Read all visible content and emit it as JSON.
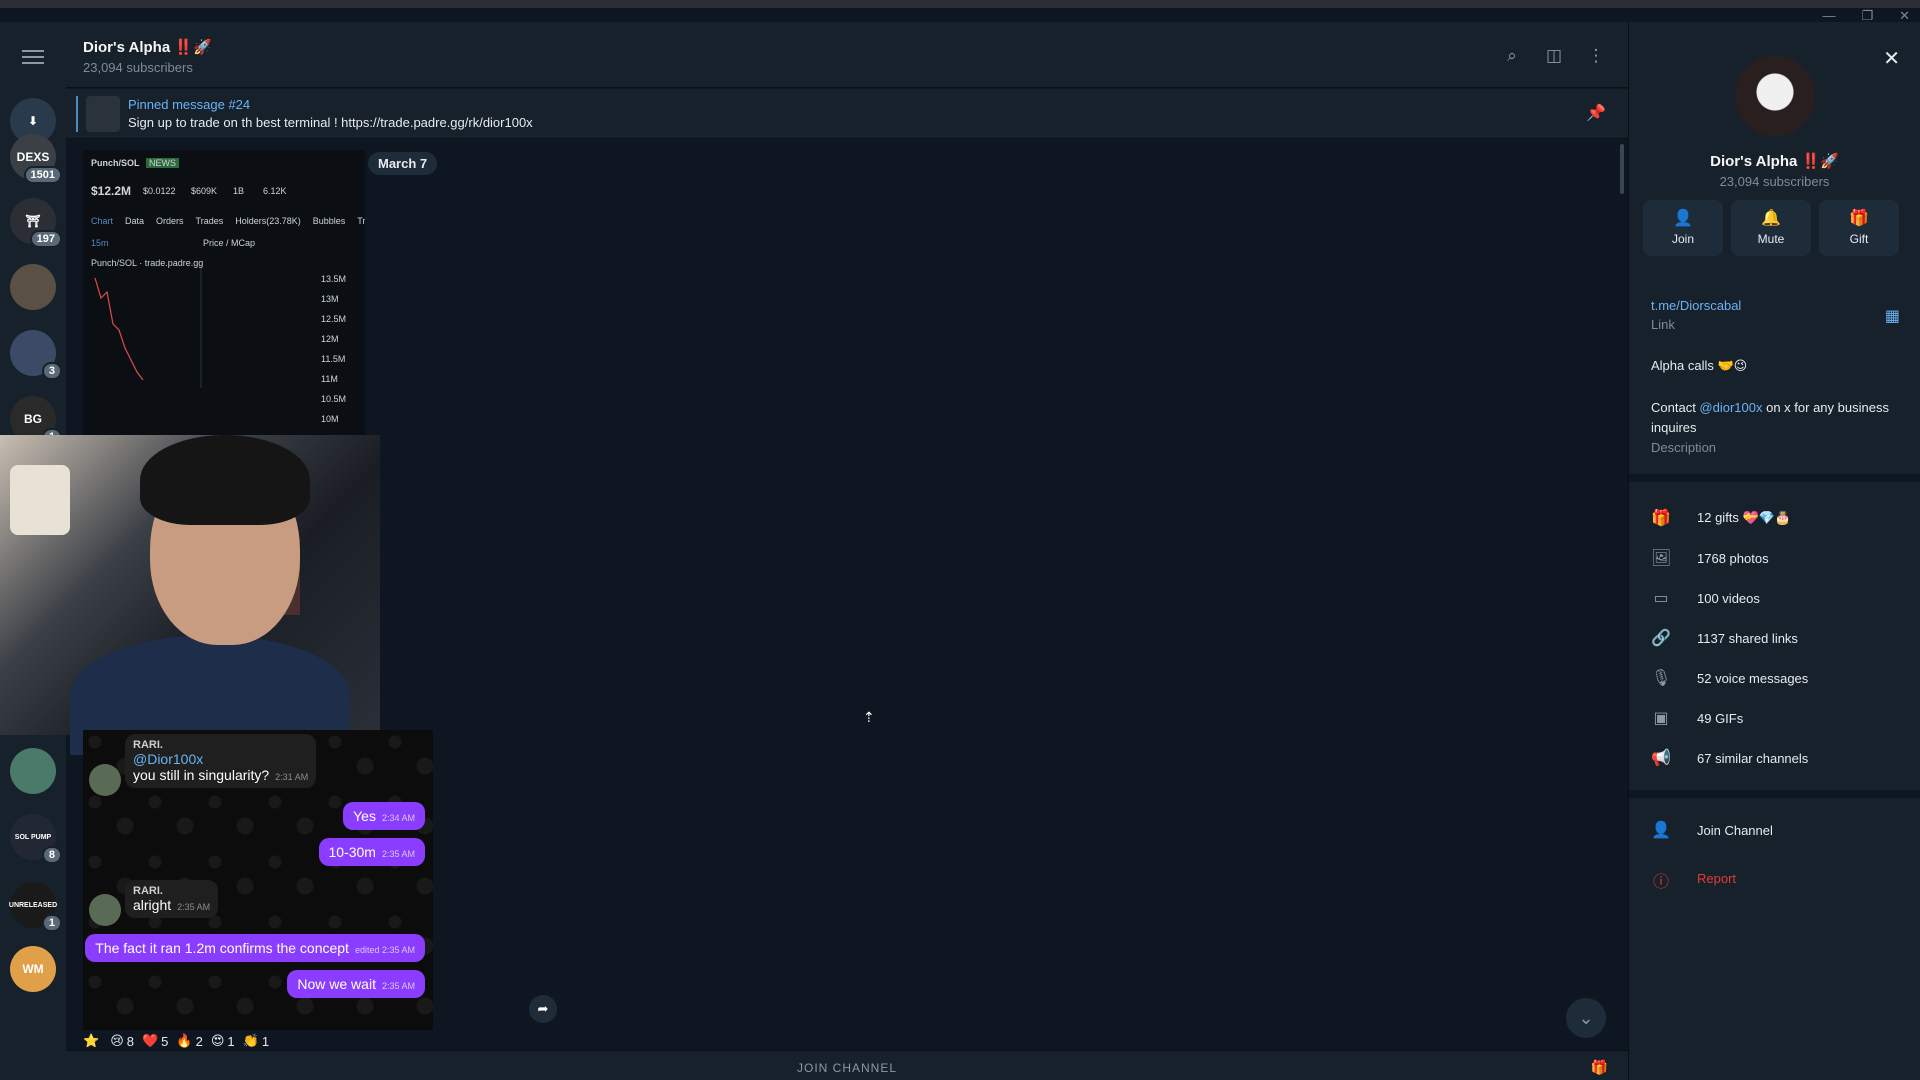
{
  "header": {
    "title": "Dior's Alpha ‼️🚀",
    "subscribers": "23,094 subscribers",
    "icons": [
      "search-icon",
      "sidebar-toggle-icon",
      "more-vertical-icon"
    ]
  },
  "pinned": {
    "title": "Pinned message #24",
    "text": "Sign up to trade on th best terminal ! https://trade.padre.gg/rk/dior100x"
  },
  "sidebar": {
    "chats": [
      {
        "label": "DEXS",
        "badge": "1501",
        "color": "#3b3f46"
      },
      {
        "label": "⛩",
        "badge": "197",
        "color": "#2b2f35"
      },
      {
        "label": "",
        "badge": "",
        "color": "#5a5044"
      },
      {
        "label": "",
        "badge": "3",
        "color": "#3d4a66"
      },
      {
        "label": "BG",
        "badge": "1",
        "color": "#2a2a2a"
      },
      {
        "label": "",
        "badge": "",
        "color": "#4a7a6a"
      },
      {
        "label": "SOL PUMP",
        "badge": "8",
        "color": "#222833"
      },
      {
        "label": "UNRELEASED",
        "badge": "1",
        "color": "#1a1a1a"
      },
      {
        "label": "WM",
        "badge": "",
        "color": "#e0a04a"
      }
    ]
  },
  "chat": {
    "date": "March 7",
    "screenshot": {
      "pair": "Punch/SOL",
      "tag": "NEWS",
      "mcap": "$12.2M",
      "price": "$0.0122",
      "liquidity": "$609K",
      "supply": "1B",
      "fees": "6.12K",
      "tabs": [
        "Chart",
        "Data",
        "Orders",
        "Trades",
        "Holders(23.78K)",
        "Bubbles",
        "Trad"
      ],
      "chart_title": "Punch/SOL · trade.padre.gg",
      "timeframe": "15m",
      "price_toggle": "Price / MCap",
      "y_ticks": [
        "13.5M",
        "13M",
        "12.5M",
        "12M",
        "11.5M",
        "11M",
        "10.5M",
        "10M"
      ]
    },
    "messages": [
      {
        "type": "in",
        "name": "RARI.",
        "mention": "@Dior100x",
        "text": "you still in singularity?",
        "time": "2:31 AM"
      },
      {
        "type": "out",
        "text": "Yes",
        "time": "2:34 AM"
      },
      {
        "type": "out",
        "text": "10-30m",
        "time": "2:35 AM"
      },
      {
        "type": "in",
        "name": "RARI.",
        "text": "alright",
        "time": "2:35 AM"
      },
      {
        "type": "out",
        "text": "The fact it ran 1.2m confirms the concept",
        "time": "edited 2:35 AM"
      },
      {
        "type": "out",
        "text": "Now we wait",
        "time": "2:35 AM"
      }
    ],
    "reactions": [
      {
        "emoji": "⭐",
        "count": ""
      },
      {
        "emoji": "😢",
        "count": "8"
      },
      {
        "emoji": "❤️",
        "count": "5"
      },
      {
        "emoji": "🔥",
        "count": "2"
      },
      {
        "emoji": "😍",
        "count": "1"
      },
      {
        "emoji": "👏",
        "count": "1"
      }
    ],
    "join_label": "JOIN CHANNEL"
  },
  "panel": {
    "name": "Dior's Alpha ‼️🚀",
    "subscribers": "23,094 subscribers",
    "buttons": [
      {
        "label": "Join",
        "icon": "👤"
      },
      {
        "label": "Mute",
        "icon": "🔔"
      },
      {
        "label": "Gift",
        "icon": "🎁"
      }
    ],
    "link": "t.me/Diorscabal",
    "link_label": "Link",
    "about": "Alpha calls 🤝😉",
    "contact_prefix": "Contact ",
    "contact_mention": "@dior100x",
    "contact_suffix": " on x for any business inquires",
    "description_label": "Description",
    "stats": [
      {
        "icon": "gift-icon",
        "glyph": "🎁",
        "label": "12 gifts 💝💎🎂"
      },
      {
        "icon": "photo-icon",
        "glyph": "🖼",
        "label": "1768 photos"
      },
      {
        "icon": "video-icon",
        "glyph": "▭",
        "label": "100 videos"
      },
      {
        "icon": "link-icon",
        "glyph": "🔗",
        "label": "1137 shared links"
      },
      {
        "icon": "microphone-icon",
        "glyph": "🎙",
        "label": "52 voice messages"
      },
      {
        "icon": "gif-icon",
        "glyph": "▣",
        "label": "49 GIFs"
      },
      {
        "icon": "megaphone-icon",
        "glyph": "📢",
        "label": "67 similar channels"
      }
    ],
    "join_channel": "Join Channel",
    "report": "Report"
  },
  "colors": {
    "accent": "#6ab3f3",
    "outgoing": "#8b3dff",
    "report": "#e53935"
  }
}
